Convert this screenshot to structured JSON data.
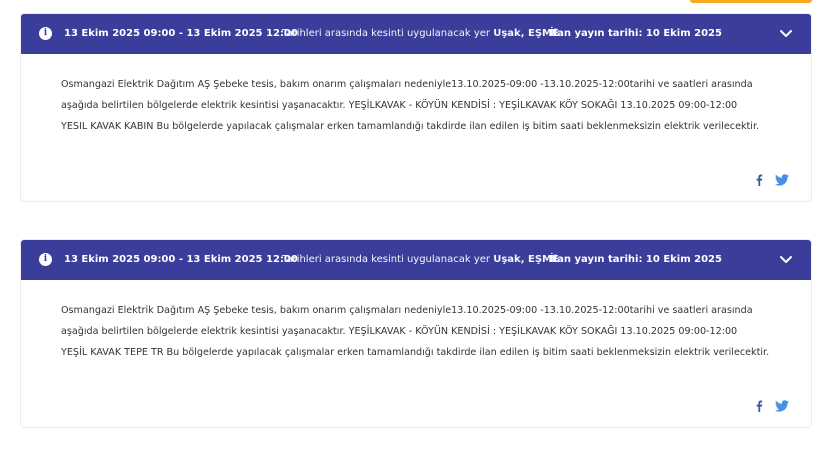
{
  "outages": [
    {
      "date_range": "13 Ekim 2025 09:00 - 13 Ekim 2025 12:00",
      "location_prefix": "Tarihleri arasında kesinti uygulanacak yer",
      "location": "Uşak, EŞME",
      "publish": "İlan yayın tarihi: 10 Ekim 2025",
      "line1": "Osmangazi Elektrik Dağıtım AŞ Şebeke tesis, bakım onarım çalışmaları nedeniyle13.10.2025-09:00 -13.10.2025-12:00tarihi ve saatleri arasında",
      "line2": "aşağıda belirtilen bölgelerde elektrik kesintisi yaşanacaktır. YEŞİLKAVAK - KÖYÜN KENDİSİ : YEŞİLKAVAK KÖY SOKAĞI 13.10.2025 09:00-12:00",
      "line3": "YESIL KAVAK KABIN Bu bölgelerde yapılacak çalışmalar erken tamamlandığı takdirde ilan edilen iş bitim saati beklenmeksizin elektrik verilecektir."
    },
    {
      "date_range": "13 Ekim 2025 09:00 - 13 Ekim 2025 12:00",
      "location_prefix": "Tarihleri arasında kesinti uygulanacak yer",
      "location": "Uşak, EŞME",
      "publish": "İlan yayın tarihi: 10 Ekim 2025",
      "line1": "Osmangazi Elektrik Dağıtım AŞ Şebeke tesis, bakım onarım çalışmaları nedeniyle13.10.2025-09:00 -13.10.2025-12:00tarihi ve saatleri arasında",
      "line2": "aşağıda belirtilen bölgelerde elektrik kesintisi yaşanacaktır. YEŞİLKAVAK - KÖYÜN KENDİSİ : YEŞİLKAVAK KÖY SOKAĞI 13.10.2025 09:00-12:00",
      "line3": "YEŞİL KAVAK TEPE TR Bu bölgelerde yapılacak çalışmalar erken tamamlandığı takdirde ilan edilen iş bitim saati beklenmeksizin elektrik verilecektir."
    }
  ],
  "icons": {
    "info": "info-icon",
    "chevron": "chevron-down-icon",
    "facebook": "facebook-icon",
    "twitter": "twitter-icon"
  },
  "colors": {
    "header": "#3a3d9a",
    "accent": "#f5a623",
    "social": "#3b5998",
    "twitter": "#4a90e2"
  },
  "info_glyph": "i"
}
